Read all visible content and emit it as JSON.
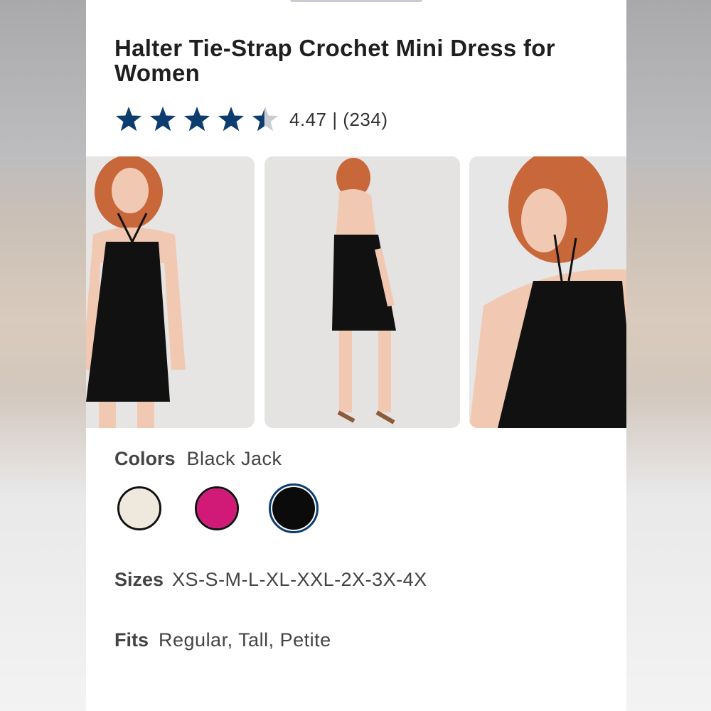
{
  "product": {
    "title": "Halter Tie-Strap Crochet Mini Dress for Women",
    "rating_value": 4.47,
    "rating_text": "4.47 | (234)"
  },
  "stars": {
    "count": 5,
    "filled_color": "#0d3c6e",
    "empty_color": "#c9ccd3"
  },
  "gallery": {
    "images": [
      {
        "name": "front-view-photo"
      },
      {
        "name": "back-view-photo"
      },
      {
        "name": "side-closeup-photo"
      }
    ]
  },
  "colors": {
    "label": "Colors",
    "selected": "Black Jack",
    "swatches": [
      {
        "name": "cream",
        "hex": "#efe8dc"
      },
      {
        "name": "pink",
        "hex": "#d11a78"
      },
      {
        "name": "black",
        "hex": "#0b0b0b",
        "selected": true
      }
    ]
  },
  "sizes": {
    "label": "Sizes",
    "value": "XS-S-M-L-XL-XXL-2X-3X-4X"
  },
  "fits": {
    "label": "Fits",
    "value": "Regular, Tall, Petite"
  }
}
